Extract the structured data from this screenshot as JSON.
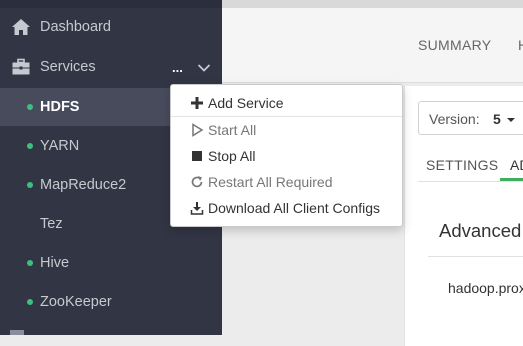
{
  "sidebar": {
    "items": [
      {
        "label": "Dashboard",
        "icon": "home-icon"
      },
      {
        "label": "Services",
        "icon": "briefcase-icon"
      }
    ],
    "services_ellipsis": "...",
    "services": [
      {
        "label": "HDFS",
        "status": "running",
        "active": true
      },
      {
        "label": "YARN",
        "status": "running"
      },
      {
        "label": "MapReduce2",
        "status": "running"
      },
      {
        "label": "Tez",
        "status": "none"
      },
      {
        "label": "Hive",
        "status": "running"
      },
      {
        "label": "ZooKeeper",
        "status": "running"
      }
    ]
  },
  "main": {
    "tabs": [
      {
        "label": "SUMMARY"
      },
      {
        "label": "H"
      }
    ],
    "version": {
      "label": "Version:",
      "value": "5"
    },
    "subtabs": [
      {
        "label": "SETTINGS"
      },
      {
        "label": "AD"
      }
    ],
    "section_title": "Advanced",
    "row_text": "hadoop.prox"
  },
  "menu": {
    "items": [
      {
        "label": "Add Service",
        "icon": "plus-icon"
      },
      {
        "label": "Start All",
        "icon": "play-icon"
      },
      {
        "label": "Stop All",
        "icon": "stop-icon"
      },
      {
        "label": "Restart All Required",
        "icon": "restart-icon"
      },
      {
        "label": "Download All Client Configs",
        "icon": "download-icon"
      }
    ]
  },
  "colors": {
    "sidebar_bg": "#323544",
    "sidebar_active_bg": "#474b5c",
    "status_green": "#3fbf7f",
    "accent_green": "#3fae5f"
  }
}
